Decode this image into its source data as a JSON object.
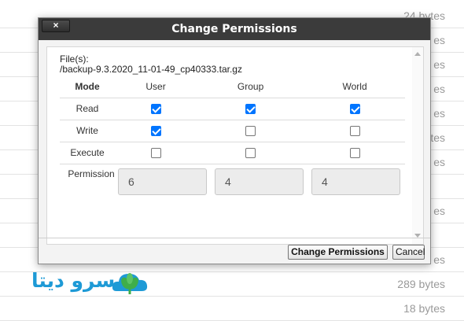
{
  "background": {
    "file_sizes": [
      "24 bytes",
      "es",
      "es",
      "es",
      "es",
      "ytes",
      "es",
      "",
      "es",
      "",
      "es",
      "289 bytes",
      "18 bytes"
    ]
  },
  "dialog": {
    "title": "Change Permissions",
    "close_label": "×",
    "files_label": "File(s):",
    "file_name": "/backup-9.3.2020_11-01-49_cp40333.tar.gz",
    "columns": [
      "Mode",
      "User",
      "Group",
      "World"
    ],
    "rows": [
      {
        "label": "Read",
        "user": true,
        "group": true,
        "world": true
      },
      {
        "label": "Write",
        "user": true,
        "group": false,
        "world": false
      },
      {
        "label": "Execute",
        "user": false,
        "group": false,
        "world": false
      }
    ],
    "permission_label": "Permission",
    "permission_values": [
      "6",
      "4",
      "4"
    ],
    "buttons": {
      "change": "Change Permissions",
      "cancel": "Cancel"
    }
  },
  "watermark": {
    "text": "سرو دیتا"
  },
  "colors": {
    "titlebar": "#3b3b3b",
    "checkbox_checked": "#0075ff",
    "logo": "#1e9ad6",
    "logo_leaf": "#3fae49"
  }
}
